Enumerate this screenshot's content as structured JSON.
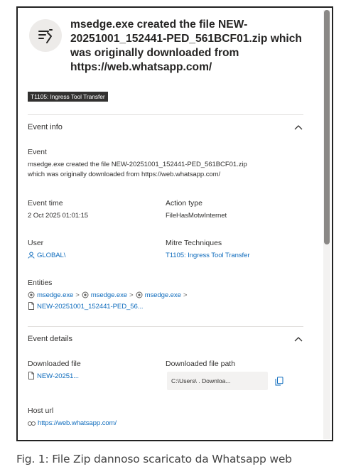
{
  "header": {
    "title": "msedge.exe created the file NEW-20251001_152441-PED_561BCF01.zip which was originally downloaded from https://web.whatsapp.com/",
    "icon": "file-create-icon",
    "tag": "T1105: Ingress Tool Transfer"
  },
  "event_info": {
    "title": "Event info",
    "event_label": "Event",
    "event_line1": "msedge.exe created the file NEW-20251001_152441-PED_561BCF01.zip",
    "event_line2": "which was originally downloaded from https://web.whatsapp.com/",
    "event_time_label": "Event time",
    "event_time": "2 Oct 2025 01:01:15",
    "action_type_label": "Action type",
    "action_type": "FileHasMotwInternet",
    "user_label": "User",
    "user": "GLOBAL\\",
    "mitre_label": "Mitre Techniques",
    "mitre": "T1105: Ingress Tool Transfer",
    "entities_label": "Entities",
    "entities": [
      "msedge.exe",
      "msedge.exe",
      "msedge.exe"
    ],
    "entity_file": "NEW-20251001_152441-PED_56..."
  },
  "event_details": {
    "title": "Event details",
    "downloaded_file_label": "Downloaded file",
    "downloaded_file": "NEW-20251...",
    "downloaded_path_label": "Downloaded file path",
    "downloaded_path": "C:\\Users\\   .        Downloa...",
    "host_url_label": "Host url",
    "host_url": "https://web.whatsapp.com/"
  },
  "caption": "Fig. 1: File Zip dannoso scaricato da Whatsapp web",
  "colors": {
    "link": "#0f6cbd",
    "tag_bg": "#323130",
    "text": "#323130"
  }
}
